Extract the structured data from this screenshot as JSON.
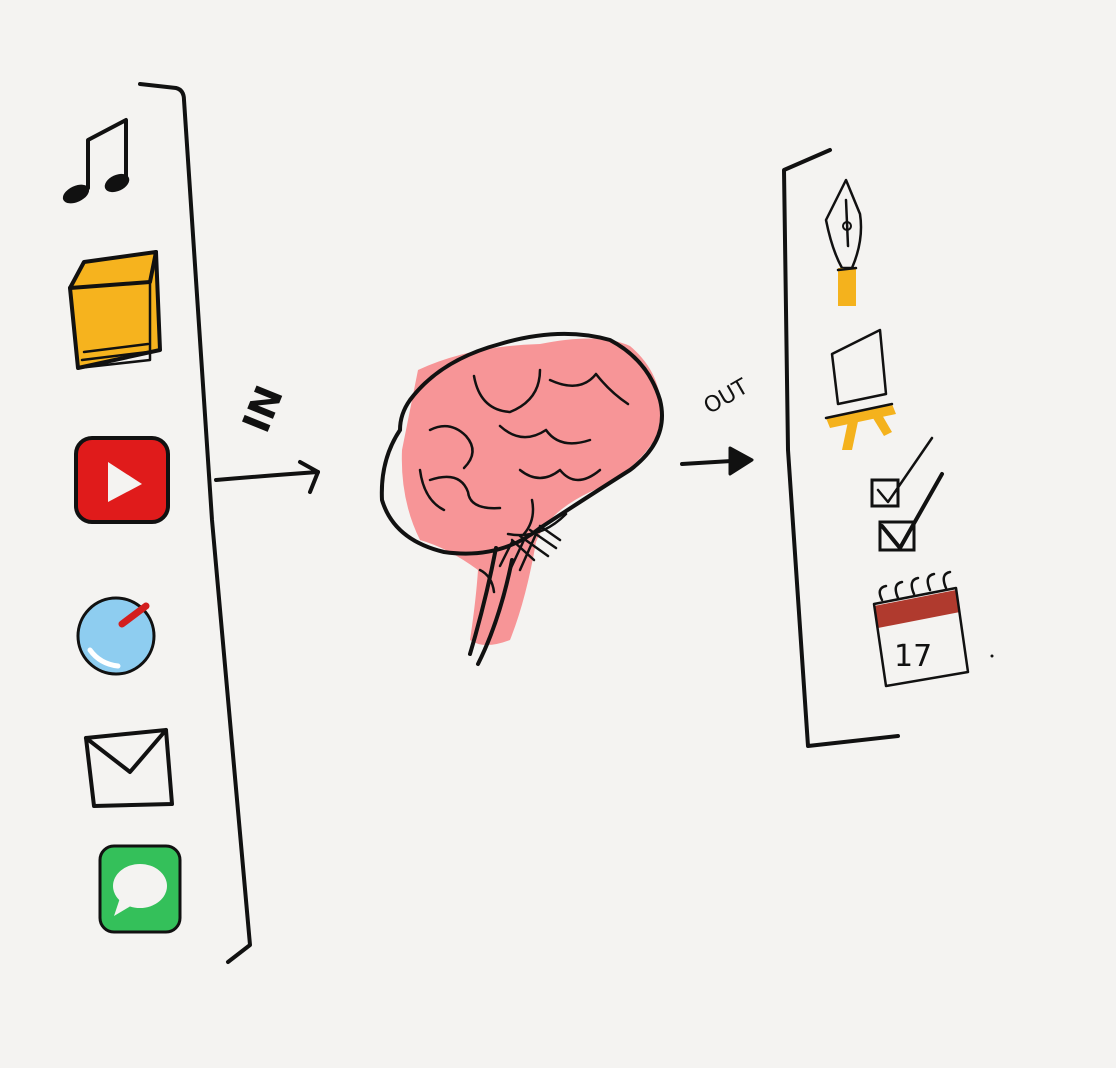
{
  "labels": {
    "in": "IN",
    "out": "OUT",
    "calendar_day": "17"
  },
  "inputs": [
    {
      "icon": "music-note-icon"
    },
    {
      "icon": "book-icon",
      "color": "#f6b31e"
    },
    {
      "icon": "youtube-play-icon",
      "color": "#e01b1b"
    },
    {
      "icon": "safari-compass-icon",
      "color": "#8ecdf0"
    },
    {
      "icon": "mail-envelope-icon"
    },
    {
      "icon": "messages-bubble-icon",
      "color": "#34c05a"
    }
  ],
  "outputs": [
    {
      "icon": "fountain-pen-icon",
      "color": "#f4b21d"
    },
    {
      "icon": "easel-icon",
      "color": "#f4b21d"
    },
    {
      "icon": "checklist-icon"
    },
    {
      "icon": "calendar-icon",
      "color": "#b03a2e"
    }
  ],
  "center": {
    "icon": "brain-icon",
    "color": "#f79597"
  },
  "colors": {
    "background": "#f4f3f1",
    "ink": "#111111"
  }
}
